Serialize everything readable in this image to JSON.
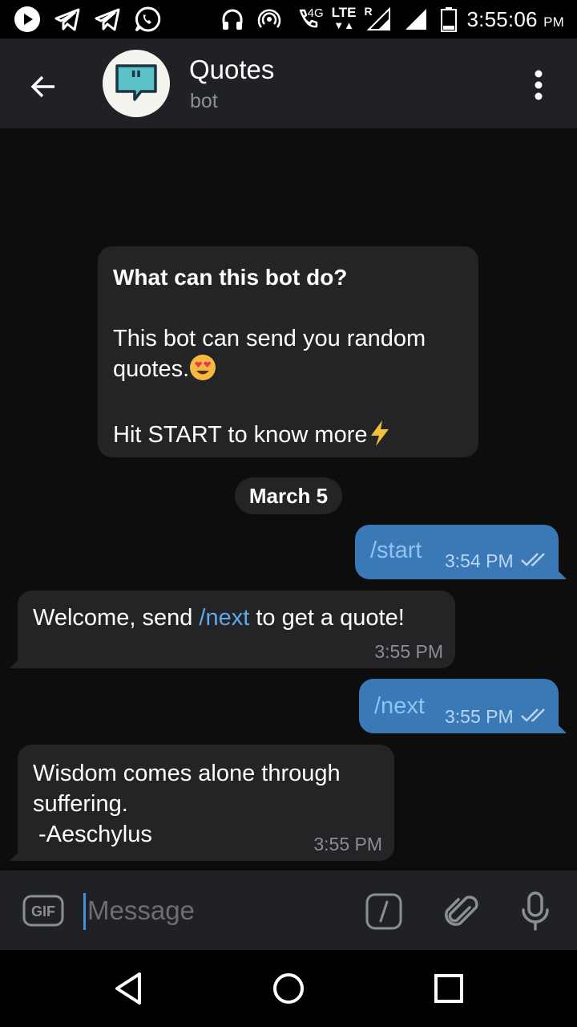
{
  "status_bar": {
    "time": "3:55:06",
    "ampm": "PM",
    "network_label": "4G",
    "lte_label": "LTE",
    "roaming_label": "R"
  },
  "header": {
    "title": "Quotes",
    "subtitle": "bot"
  },
  "chat": {
    "intro": {
      "question": "What can this bot do?",
      "line1": "This bot can send you random quotes.",
      "line2": "Hit START to know more"
    },
    "date_separator": "March 5",
    "messages": [
      {
        "direction": "out",
        "text": "/start",
        "time": "3:54 PM",
        "status": "read"
      },
      {
        "direction": "in",
        "text_before": "Welcome, send ",
        "link": "/next",
        "text_after": " to get a quote!",
        "time": "3:55 PM"
      },
      {
        "direction": "out",
        "text": "/next",
        "time": "3:55 PM",
        "status": "read"
      },
      {
        "direction": "in",
        "line1": "Wisdom comes alone through",
        "line2": "suffering.",
        "line3": "-Aeschylus",
        "time": "3:55 PM"
      }
    ]
  },
  "input_bar": {
    "gif_label": "GIF",
    "placeholder": "Message"
  },
  "colors": {
    "background": "#0d0d0e",
    "header": "#202124",
    "bubble_in": "#242426",
    "bubble_out": "#3b78b6",
    "link": "#5ea8ec",
    "cursor": "#4a90d9"
  },
  "icons": [
    "play-icon",
    "telegram-icon",
    "telegram-icon",
    "whatsapp-icon",
    "headphones-icon",
    "hotspot-icon",
    "wifi-calling-icon",
    "signal-icon",
    "battery-icon",
    "back-arrow-icon",
    "quote-bubble-icon",
    "more-vertical-icon",
    "double-check-icon",
    "slash-command-icon",
    "paperclip-icon",
    "microphone-icon",
    "nav-back-icon",
    "nav-home-icon",
    "nav-recents-icon"
  ]
}
